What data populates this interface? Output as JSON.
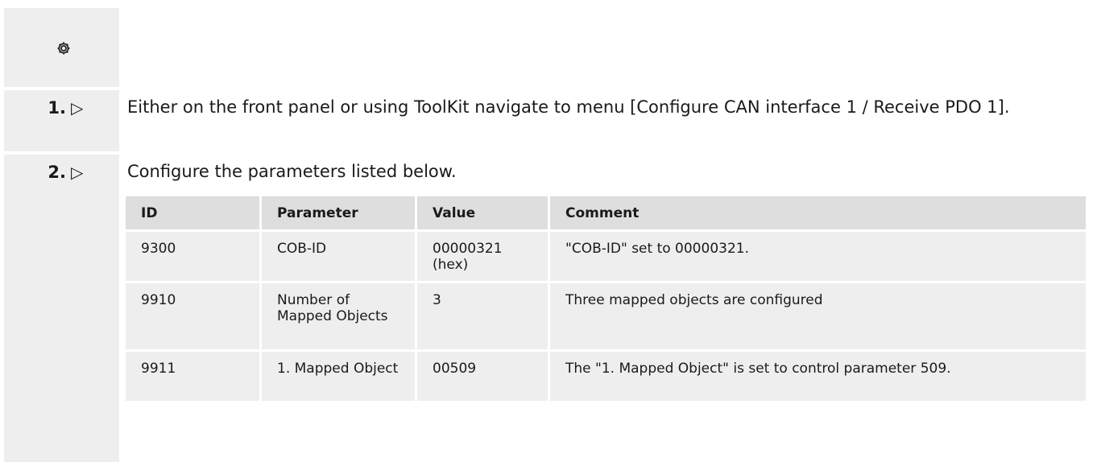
{
  "header": {
    "icon": "gear-icon"
  },
  "steps": [
    {
      "number": "1.",
      "arrow": "▷",
      "text": "Either on the front panel or using ToolKit navigate to menu [Configure CAN interface 1 / Receive PDO 1]."
    },
    {
      "number": "2.",
      "arrow": "▷",
      "text": "Configure the parameters listed below."
    }
  ],
  "table": {
    "columns": [
      "ID",
      "Parameter",
      "Value",
      "Comment"
    ],
    "rows": [
      [
        "9300",
        "COB-ID",
        "00000321 (hex)",
        "\"COB-ID\" set to 00000321."
      ],
      [
        "9910",
        "Number of Mapped Objects",
        "3",
        "Three mapped objects are configured"
      ],
      [
        "9911",
        "1. Mapped Object",
        "00509",
        "The \"1. Mapped Object\" is set to control parameter 509."
      ]
    ]
  }
}
